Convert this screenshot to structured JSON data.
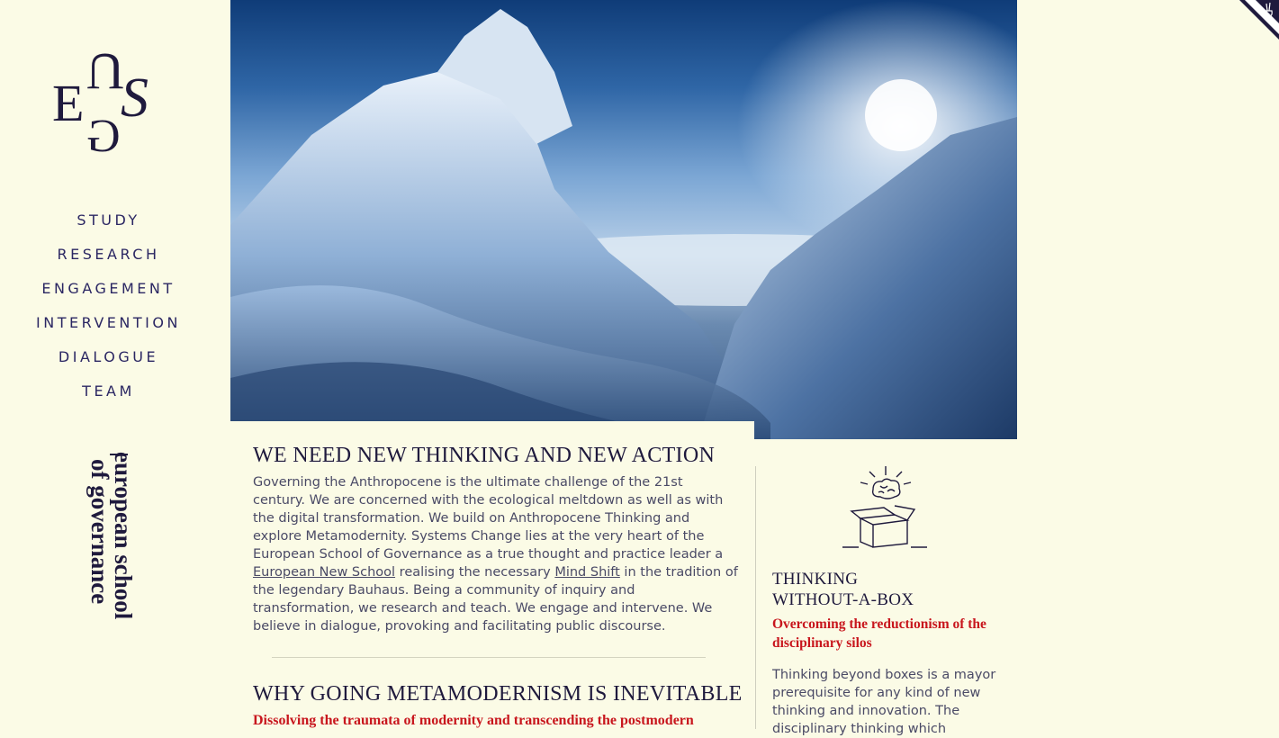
{
  "logo": {
    "letters": [
      "E",
      "U",
      "S",
      "G"
    ]
  },
  "nav": {
    "items": [
      {
        "label": "STUDY"
      },
      {
        "label": "RESEARCH"
      },
      {
        "label": "ENGAGEMENT"
      },
      {
        "label": "INTERVENTION"
      },
      {
        "label": "DIALOGUE"
      },
      {
        "label": "TEAM"
      }
    ]
  },
  "brand": {
    "line1": "european school",
    "line2": "of governance"
  },
  "hero": {
    "image": "snowy-mountain-ridge-video"
  },
  "article": {
    "heading": "WE NEED NEW THINKING AND NEW ACTION",
    "body_part1": "Governing the Anthropocene is the ultimate challenge of the 21st century. We are concerned with the ecological meltdown as well as with the digital transformation. We build on Anthropocene Thinking and explore Metamodernity. Systems Change lies at the very heart of the European School of Governance as a true thought and practice leader a ",
    "link1": "European New School",
    "body_part2": " realising the necessary ",
    "link2": "Mind Shift",
    "body_part3": " in the tradition of the legendary Bauhaus. Being a community of inquiry and transformation, we research and teach. We engage and intervene. We believe in dialogue, provoking and facilitating public discourse.",
    "heading2": "WHY GOING METAMODERNISM IS INEVITABLE",
    "subheading2": "Dissolving the traumata of modernity and transcending the postmodern"
  },
  "card": {
    "icon": "brain-box-icon",
    "title_line1": "THINKING",
    "title_line2": "WITHOUT-A-BOX",
    "subtitle": "Overcoming the reductionism of the disciplinary silos",
    "body": "Thinking beyond boxes is a mayor prerequisite for any kind of new thinking and innovation. The disciplinary thinking which"
  },
  "corner_badge": {
    "icon": "peace-hand-icon"
  },
  "colors": {
    "background": "#fbfbe6",
    "navy": "#1f1a3d",
    "nav_text": "#2b2763",
    "accent_red": "#c8161d",
    "body_text": "#4a4a66"
  }
}
